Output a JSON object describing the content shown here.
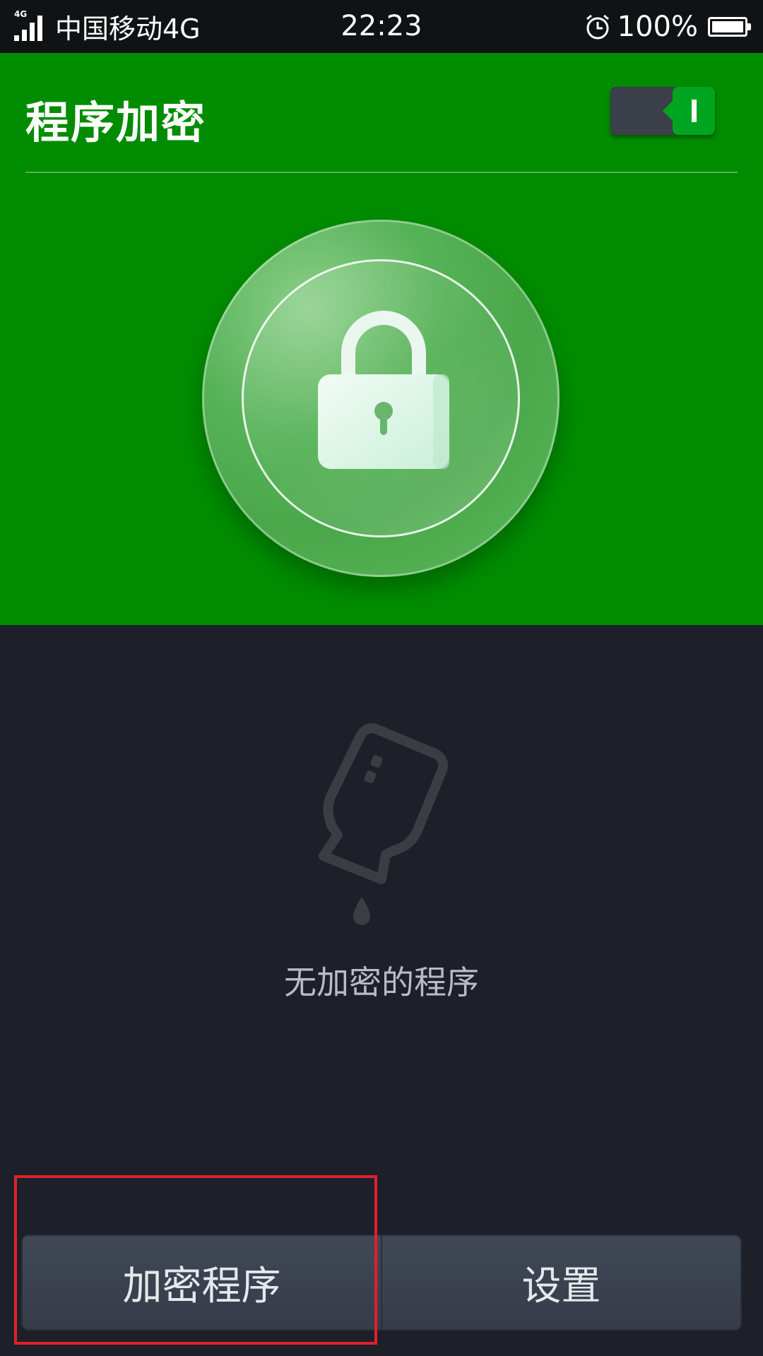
{
  "status_bar": {
    "network_label": "4G",
    "carrier": "中国移动4G",
    "time": "22:23",
    "battery": "100%",
    "battery_level_fraction": 1.0,
    "icons": [
      "signal-icon",
      "alarm-icon",
      "battery-icon"
    ]
  },
  "header": {
    "title": "程序加密",
    "toggle_state": "on",
    "background_color": "#008c00"
  },
  "empty_state": {
    "message": "无加密的程序",
    "icon": "empty-bottle-icon"
  },
  "actions": {
    "encrypt_label": "加密程序",
    "settings_label": "设置"
  },
  "colors": {
    "accent": "#008c00",
    "background": "#1d2029",
    "highlight": "#e0202a"
  }
}
